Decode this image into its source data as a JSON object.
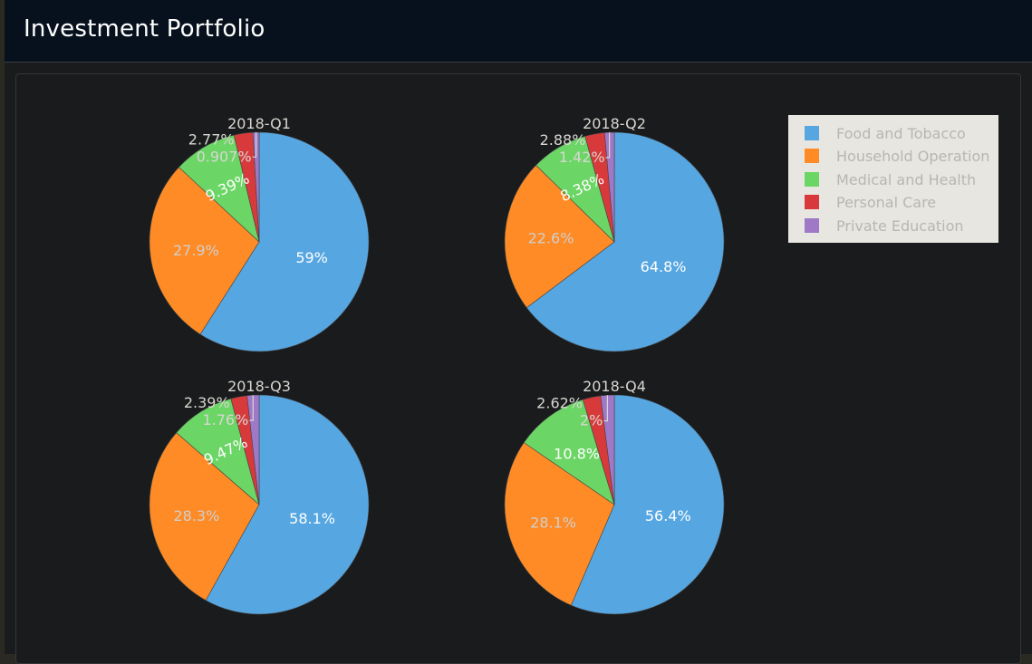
{
  "header": {
    "title": "Investment Portfolio"
  },
  "colors": {
    "Food and Tobacco": "#56a6e1",
    "Household Operation": "#fe8b25",
    "Medical and Health": "#6bd665",
    "Personal Care": "#d83a3c",
    "Private Education": "#9f79c8"
  },
  "legend": {
    "items": [
      "Food and Tobacco",
      "Household Operation",
      "Medical and Health",
      "Personal Care",
      "Private Education"
    ]
  },
  "chart_data": [
    {
      "type": "pie",
      "title": "2018-Q1",
      "labels": [
        "Food and Tobacco",
        "Household Operation",
        "Medical and Health",
        "Personal Care",
        "Private Education"
      ],
      "values": [
        59,
        27.9,
        9.39,
        2.77,
        0.907
      ],
      "value_labels": [
        "59%",
        "27.9%",
        "9.39%",
        "2.77%",
        "0.907%"
      ]
    },
    {
      "type": "pie",
      "title": "2018-Q2",
      "labels": [
        "Food and Tobacco",
        "Household Operation",
        "Medical and Health",
        "Personal Care",
        "Private Education"
      ],
      "values": [
        64.8,
        22.6,
        8.38,
        2.88,
        1.42
      ],
      "value_labels": [
        "64.8%",
        "22.6%",
        "8.38%",
        "2.88%",
        "1.42%"
      ]
    },
    {
      "type": "pie",
      "title": "2018-Q3",
      "labels": [
        "Food and Tobacco",
        "Household Operation",
        "Medical and Health",
        "Personal Care",
        "Private Education"
      ],
      "values": [
        58.1,
        28.3,
        9.47,
        2.39,
        1.76
      ],
      "value_labels": [
        "58.1%",
        "28.3%",
        "9.47%",
        "2.39%",
        "1.76%"
      ]
    },
    {
      "type": "pie",
      "title": "2018-Q4",
      "labels": [
        "Food and Tobacco",
        "Household Operation",
        "Medical and Health",
        "Personal Care",
        "Private Education"
      ],
      "values": [
        56.4,
        28.1,
        10.8,
        2.62,
        2
      ],
      "value_labels": [
        "56.4%",
        "28.1%",
        "10.8%",
        "2.62%",
        "2%"
      ]
    }
  ]
}
